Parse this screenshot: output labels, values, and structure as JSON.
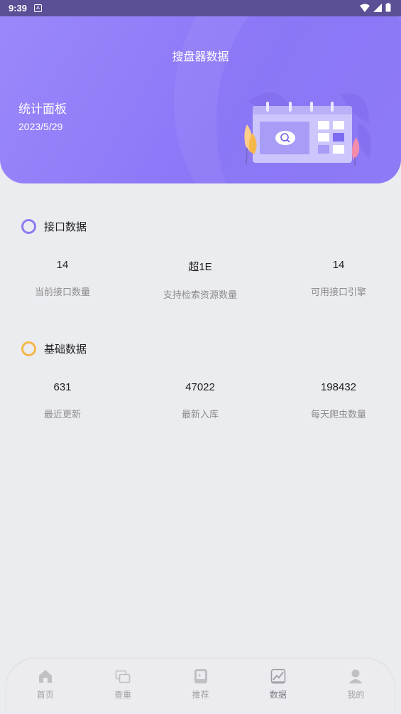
{
  "status_bar": {
    "time": "9:39"
  },
  "header": {
    "title": "搜盘器数据",
    "panel_title": "统计面板",
    "date": "2023/5/29"
  },
  "interface_section": {
    "title": "接口数据",
    "stats": [
      {
        "value": "14",
        "label": "当前接口数量"
      },
      {
        "value": "超1E",
        "label": "支持检索资源数量"
      },
      {
        "value": "14",
        "label": "可用接口引擎"
      }
    ]
  },
  "basic_section": {
    "title": "基础数据",
    "stats": [
      {
        "value": "631",
        "label": "最近更新"
      },
      {
        "value": "47022",
        "label": "最新入库"
      },
      {
        "value": "198432",
        "label": "每天爬虫数量"
      }
    ]
  },
  "bottom_nav": {
    "items": [
      {
        "label": "首页",
        "icon": "home-icon"
      },
      {
        "label": "查重",
        "icon": "duplicate-icon"
      },
      {
        "label": "推荐",
        "icon": "recommend-icon"
      },
      {
        "label": "数据",
        "icon": "chart-icon"
      },
      {
        "label": "我的",
        "icon": "user-icon"
      }
    ],
    "active": "数据"
  },
  "colors": {
    "header_gradient_start": "#9a88fb",
    "header_gradient_end": "#8b76f7",
    "ring_purple": "#8b7cf0",
    "ring_orange": "#f5b74a",
    "background": "#ebecf0"
  }
}
